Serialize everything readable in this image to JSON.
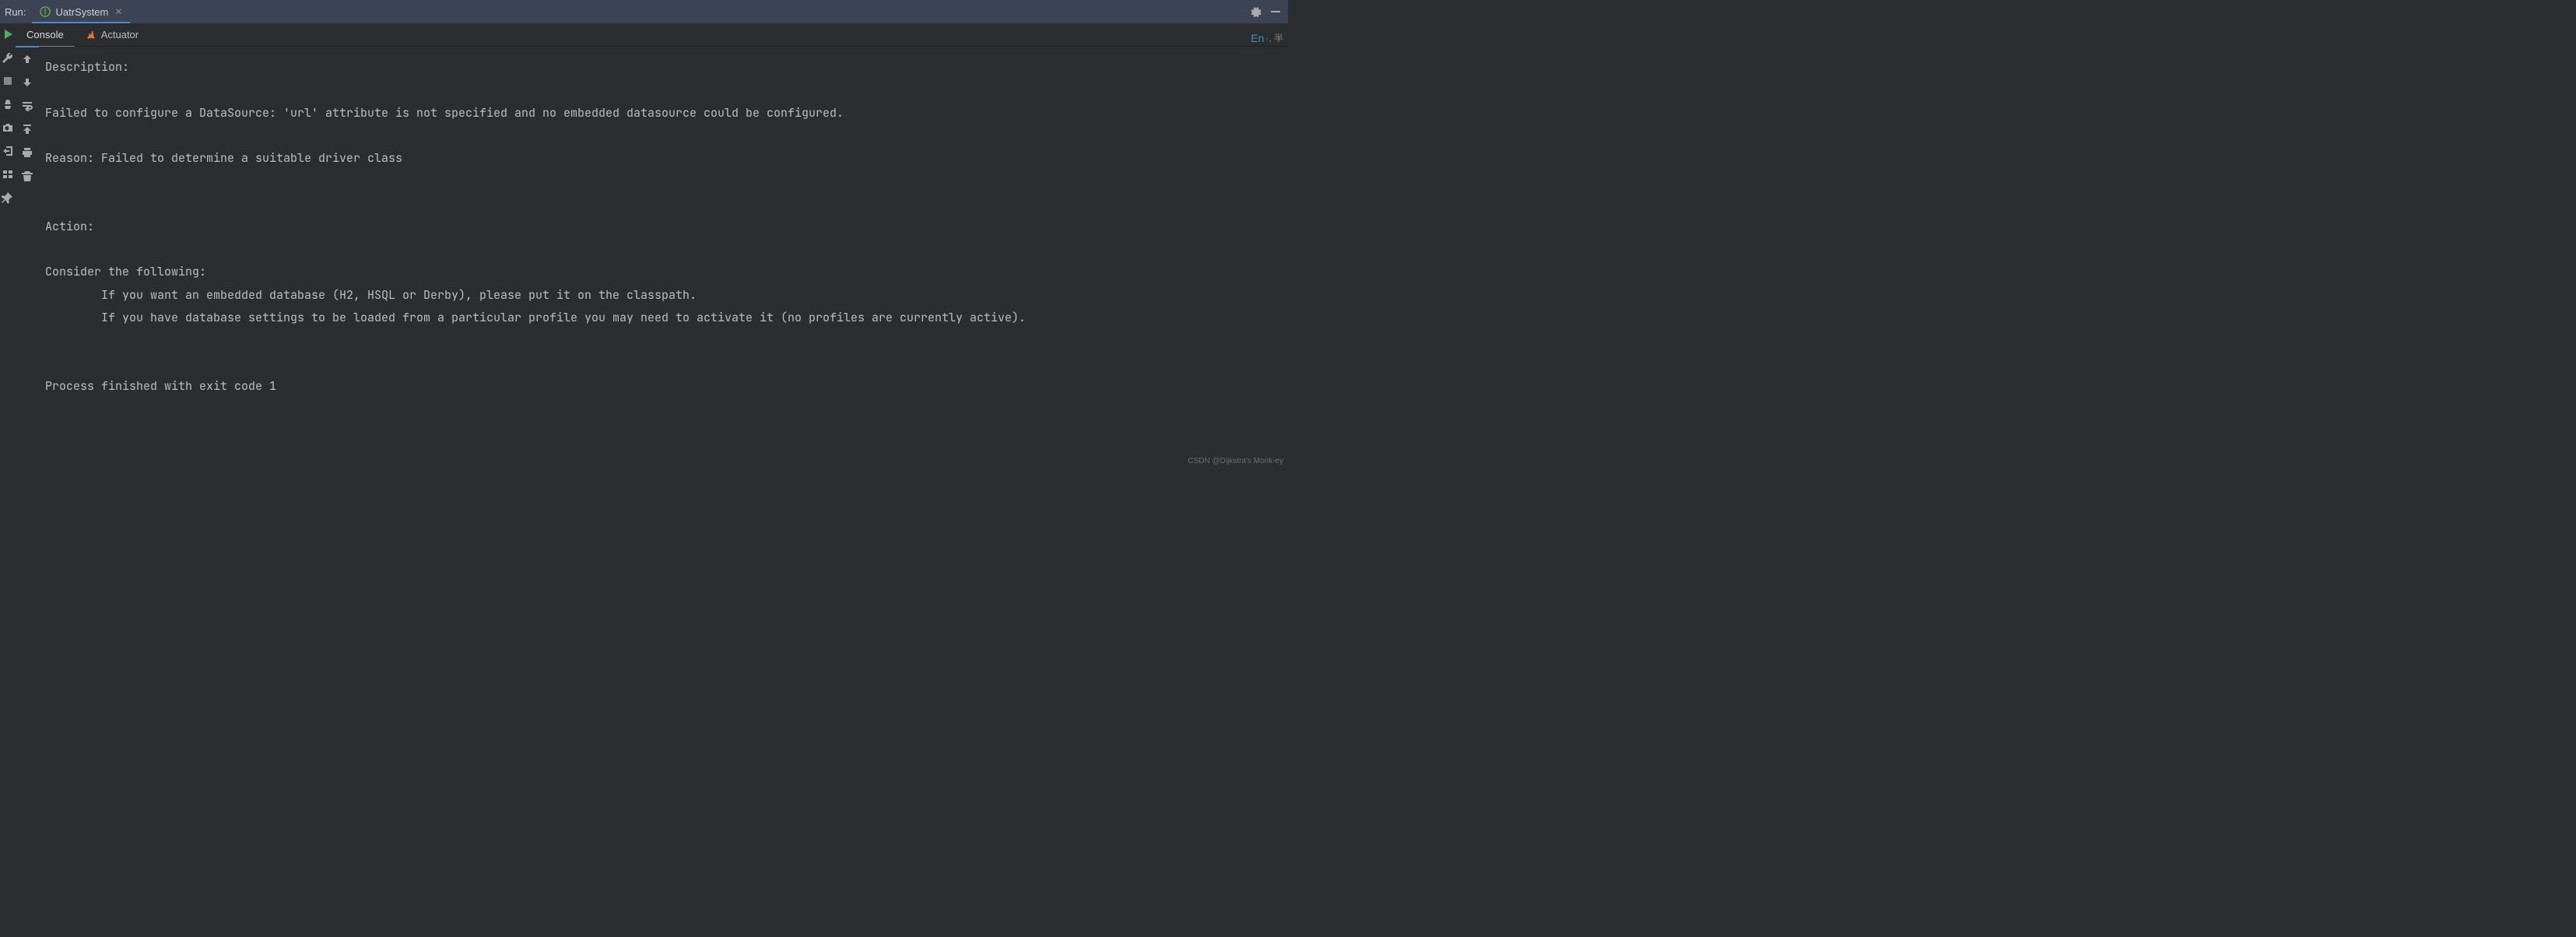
{
  "header": {
    "run_label": "Run:",
    "tab_title": "UatrSystem"
  },
  "sub_tabs": {
    "console": "Console",
    "actuator": "Actuator"
  },
  "ime": {
    "en": "En",
    "tail": "·, 半"
  },
  "console": {
    "lines": [
      "Description:",
      "",
      "Failed to configure a DataSource: 'url' attribute is not specified and no embedded datasource could be configured.",
      "",
      "Reason: Failed to determine a suitable driver class",
      "",
      "",
      "Action:",
      "",
      "Consider the following:",
      "\tIf you want an embedded database (H2, HSQL or Derby), please put it on the classpath.",
      "\tIf you have database settings to be loaded from a particular profile you may need to activate it (no profiles are currently active).",
      "",
      "",
      "Process finished with exit code 1"
    ]
  },
  "watermark": "CSDN @Dijkstra's Monk-ey"
}
